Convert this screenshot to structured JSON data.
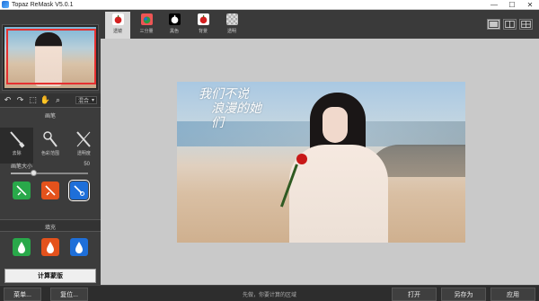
{
  "window": {
    "title": "Topaz ReMask V5.0.1",
    "controls": [
      "—",
      "☐",
      "✕"
    ]
  },
  "left_panel": {
    "mode_select": {
      "value": "混合"
    },
    "brush_section_title": "画笔",
    "brushes": [
      {
        "label": "去除",
        "icon": "brush-eraser-icon"
      },
      {
        "label": "色彩范围",
        "icon": "color-range-icon"
      },
      {
        "label": "透明度",
        "icon": "transparency-icon"
      }
    ],
    "brush_size": {
      "label": "画笔大小",
      "value": "50",
      "fraction": 0.3
    },
    "fill_section_title": "填充",
    "compute_button": "计算蒙版"
  },
  "top_tabs": [
    {
      "label": "透镜",
      "icon": "apple-red-icon",
      "active": true
    },
    {
      "label": "三分量",
      "icon": "tricolor-icon",
      "active": false
    },
    {
      "label": "黑色",
      "icon": "apple-black-icon",
      "active": false
    },
    {
      "label": "背景",
      "icon": "apple-red-icon",
      "active": false
    },
    {
      "label": "透明",
      "icon": "checker-icon",
      "active": false
    }
  ],
  "view_modes": [
    "single-view-icon",
    "split-view-icon",
    "quad-view-icon"
  ],
  "photo_text": {
    "line1": "我们不说",
    "line2": "浪漫的她们"
  },
  "status_bar": {
    "menu_button": "菜单...",
    "reset_button": "复位...",
    "hint": "先做，你要计算的区域",
    "open_button": "打开",
    "save_as_button": "另存为",
    "apply_button": "应用"
  },
  "colors": {
    "accent_red": "#e53030",
    "green": "#29a84a",
    "orange": "#e4521c",
    "blue": "#1e6fd9",
    "panel": "#3c3c3c",
    "canvas": "#c9c9c9"
  }
}
